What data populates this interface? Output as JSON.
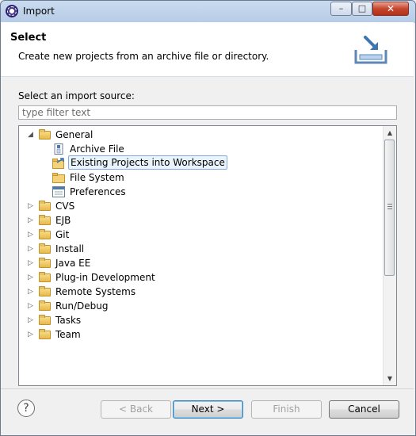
{
  "window": {
    "title": "Import",
    "controls": {
      "minimize": "–",
      "maximize": "□",
      "close": "✕"
    }
  },
  "header": {
    "title": "Select",
    "description": "Create new projects from an archive file or directory.",
    "icon": "import-wizard-icon"
  },
  "source": {
    "label": "Select an import source:",
    "filter_placeholder": "type filter text",
    "filter_value": ""
  },
  "tree": {
    "items": [
      {
        "label": "General",
        "depth": 0,
        "expanded": true,
        "icon": "folder-icon"
      },
      {
        "label": "Archive File",
        "depth": 1,
        "icon": "archive-file-icon"
      },
      {
        "label": "Existing Projects into Workspace",
        "depth": 1,
        "icon": "existing-projects-icon",
        "selected": true
      },
      {
        "label": "File System",
        "depth": 1,
        "icon": "file-system-icon"
      },
      {
        "label": "Preferences",
        "depth": 1,
        "icon": "preferences-icon"
      },
      {
        "label": "CVS",
        "depth": 0,
        "expanded": false,
        "icon": "folder-icon"
      },
      {
        "label": "EJB",
        "depth": 0,
        "expanded": false,
        "icon": "folder-icon"
      },
      {
        "label": "Git",
        "depth": 0,
        "expanded": false,
        "icon": "folder-icon"
      },
      {
        "label": "Install",
        "depth": 0,
        "expanded": false,
        "icon": "folder-icon"
      },
      {
        "label": "Java EE",
        "depth": 0,
        "expanded": false,
        "icon": "folder-icon"
      },
      {
        "label": "Plug-in Development",
        "depth": 0,
        "expanded": false,
        "icon": "folder-icon"
      },
      {
        "label": "Remote Systems",
        "depth": 0,
        "expanded": false,
        "icon": "folder-icon"
      },
      {
        "label": "Run/Debug",
        "depth": 0,
        "expanded": false,
        "icon": "folder-icon"
      },
      {
        "label": "Tasks",
        "depth": 0,
        "expanded": false,
        "icon": "folder-icon"
      },
      {
        "label": "Team",
        "depth": 0,
        "expanded": false,
        "icon": "folder-icon"
      }
    ]
  },
  "buttons": {
    "help": "?",
    "back": "< Back",
    "next": "Next >",
    "finish": "Finish",
    "cancel": "Cancel"
  }
}
